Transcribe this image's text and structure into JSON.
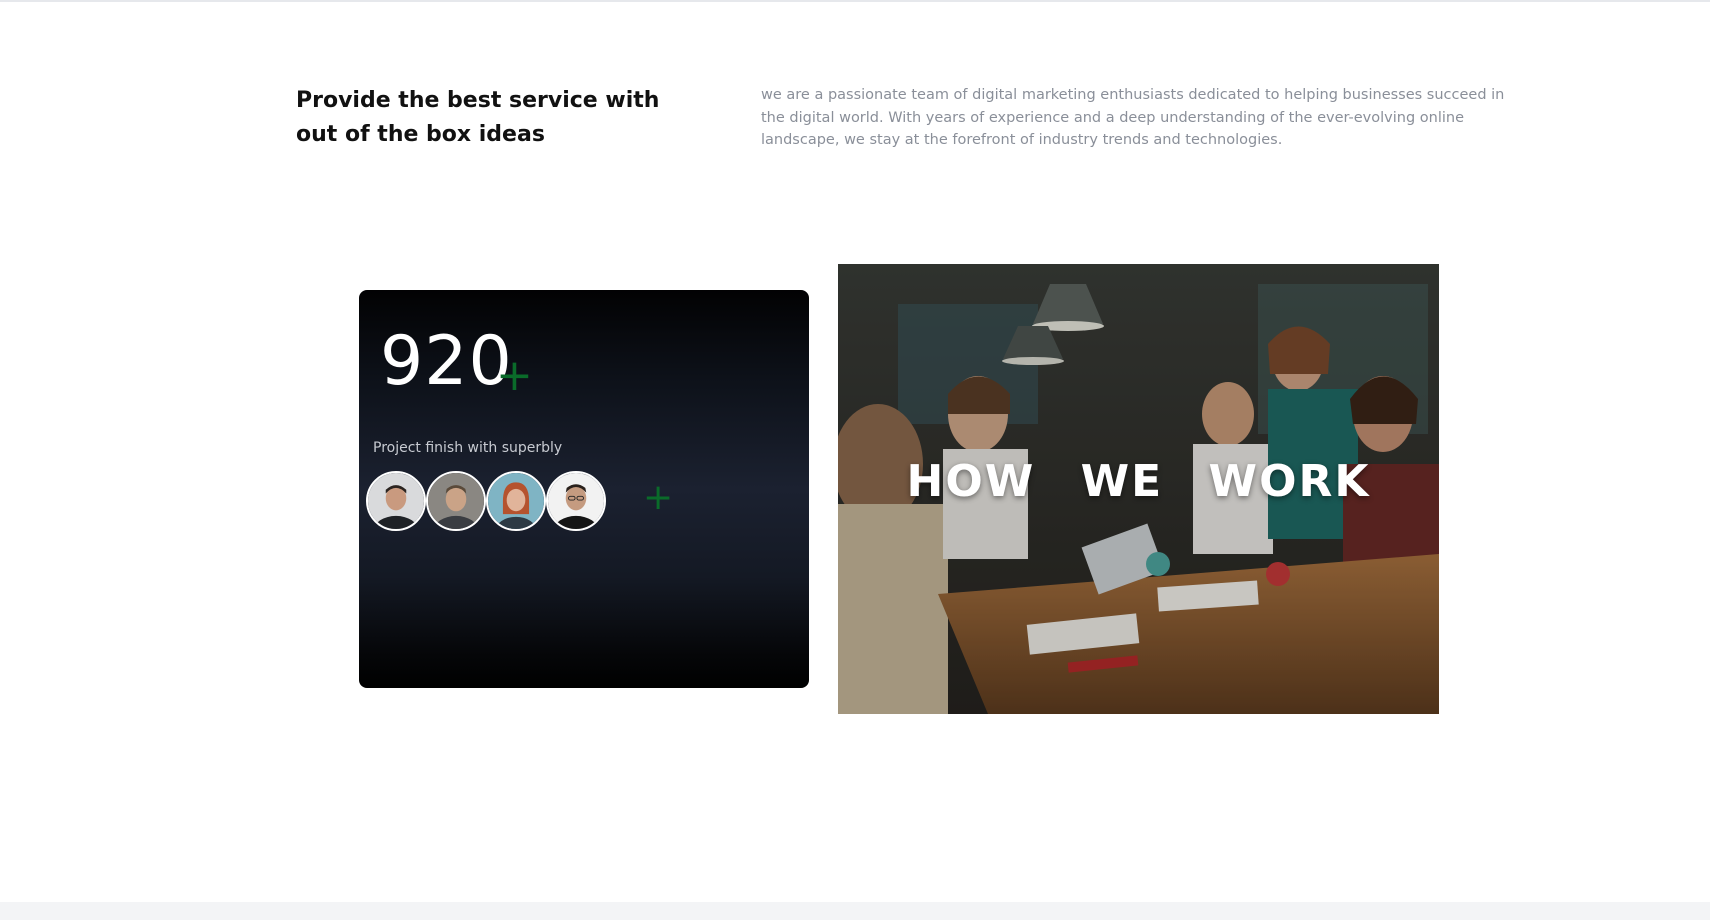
{
  "intro": {
    "heading": "Provide the best service with out of the box ideas",
    "text": "we are a passionate team of digital marketing enthusiasts dedicated to helping businesses succeed in the digital world. With years of experience and a deep understanding of the ever-evolving online landscape, we stay at the forefront of industry trends and technologies."
  },
  "stats": {
    "number": "920",
    "plus": "+",
    "caption": "Project finish with superbly",
    "avatars_plus": "+"
  },
  "photo": {
    "title": "HOW WE WORK"
  },
  "colors": {
    "accent": "#0a6b2a",
    "heading": "#111111",
    "body_text": "#8a8f99"
  }
}
